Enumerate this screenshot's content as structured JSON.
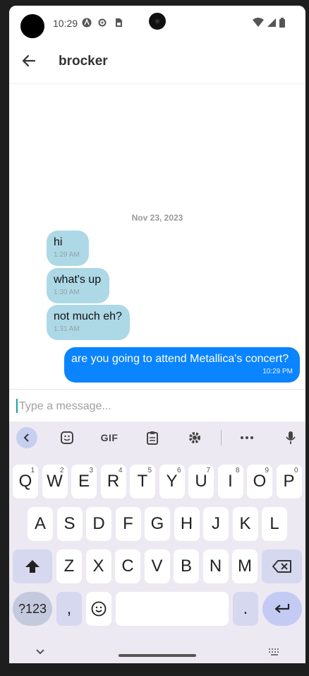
{
  "status_bar": {
    "time": "10:29"
  },
  "header": {
    "title": "brocker"
  },
  "chat": {
    "date_separator": "Nov 23, 2023",
    "messages": [
      {
        "text": "hi",
        "time": "1:29 AM",
        "direction": "in"
      },
      {
        "text": "what's up",
        "time": "1:30 AM",
        "direction": "in"
      },
      {
        "text": "not much eh?",
        "time": "1:31 AM",
        "direction": "in"
      },
      {
        "text": "are you going to attend Metallica's concert?",
        "time": "10:29 PM",
        "direction": "out"
      }
    ]
  },
  "composer": {
    "placeholder": "Type a message...",
    "value": ""
  },
  "keyboard": {
    "toolbar": {
      "gif_label": "GIF"
    },
    "row1": [
      {
        "k": "Q",
        "h": "1"
      },
      {
        "k": "W",
        "h": "2"
      },
      {
        "k": "E",
        "h": "3"
      },
      {
        "k": "R",
        "h": "4"
      },
      {
        "k": "T",
        "h": "5"
      },
      {
        "k": "Y",
        "h": "6"
      },
      {
        "k": "U",
        "h": "7"
      },
      {
        "k": "I",
        "h": "8"
      },
      {
        "k": "O",
        "h": "9"
      },
      {
        "k": "P",
        "h": "0"
      }
    ],
    "row2": [
      "A",
      "S",
      "D",
      "F",
      "G",
      "H",
      "J",
      "K",
      "L"
    ],
    "row3": [
      "Z",
      "X",
      "C",
      "V",
      "B",
      "N",
      "M"
    ],
    "symbols_label": "?123",
    "comma": ",",
    "period": "."
  },
  "colors": {
    "incoming_bubble": "#add8e6",
    "outgoing_bubble": "#0a84ff",
    "accent": "#1aa39a"
  }
}
